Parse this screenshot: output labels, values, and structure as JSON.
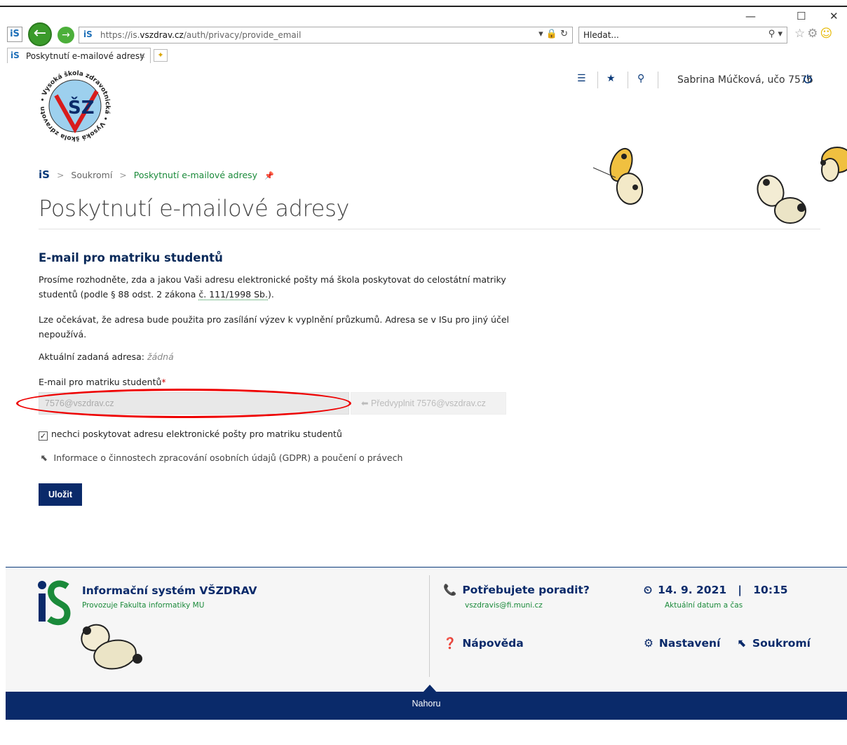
{
  "browser": {
    "window_controls": {
      "minimize": "—",
      "maximize": "☐",
      "close": "✕"
    },
    "url_prefix": "https://is.",
    "url_domain": "vszdrav.cz",
    "url_path": "/auth/privacy/provide_email",
    "search_placeholder": "Hledat...",
    "tab_label": "Poskytnutí e-mailové adresy",
    "tab_close": "×"
  },
  "header": {
    "user": "Sabrina Múčková, učo 7576",
    "logo_text": "Vysoká škola zdravotnická",
    "logo_mark": "ŠZ"
  },
  "breadcrumb": {
    "home": "iS",
    "items": [
      "Soukromí",
      "Poskytnutí e-mailové adresy"
    ]
  },
  "page_title": "Poskytnutí e-mailové adresy",
  "section": {
    "title": "E-mail pro matriku studentů",
    "p1_before": "Prosíme rozhodněte, zda a jakou Vaši adresu elektronické pošty má škola poskytovat do celostátní matriky studentů (podle § 88 odst. 2 zákona ",
    "p1_link": "č. 111/1998 Sb.",
    "p1_after": ").",
    "p2": "Lze očekávat, že adresa bude použita pro zasílání výzev k vyplnění průzkumů. Adresa se v ISu pro jiný účel nepoužívá.",
    "current_label": "Aktuální zadaná adresa:",
    "current_value": "žádná",
    "field_label": "E-mail pro matriku studentů",
    "required_mark": "*",
    "email_placeholder": "7576@vszdrav.cz",
    "prefill_label": "Předvyplnit 7576@vszdrav.cz",
    "checkbox_label": "nechci poskytovat adresu elektronické pošty pro matriku studentů",
    "checkbox_checked": true,
    "gdpr_label": "Informace o činnostech zpracování osobních údajů (GDPR) a poučení o právech",
    "save_label": "Uložit"
  },
  "footer": {
    "title": "Informační systém VŠZDRAV",
    "subtitle": "Provozuje Fakulta informatiky MU",
    "help_title": "Potřebujete poradit?",
    "help_email": "vszdravis@fi.muni.cz",
    "date": "14. 9. 2021",
    "date_sep": "|",
    "time": "10:15",
    "date_caption": "Aktuální datum a čas",
    "napoveda": "Nápověda",
    "nastaveni": "Nastavení",
    "soukromi": "Soukromí",
    "nahoru": "Nahoru"
  },
  "colors": {
    "brand_navy": "#0a2a6a",
    "brand_green": "#1a8a3a",
    "highlight_red": "#e00000"
  }
}
